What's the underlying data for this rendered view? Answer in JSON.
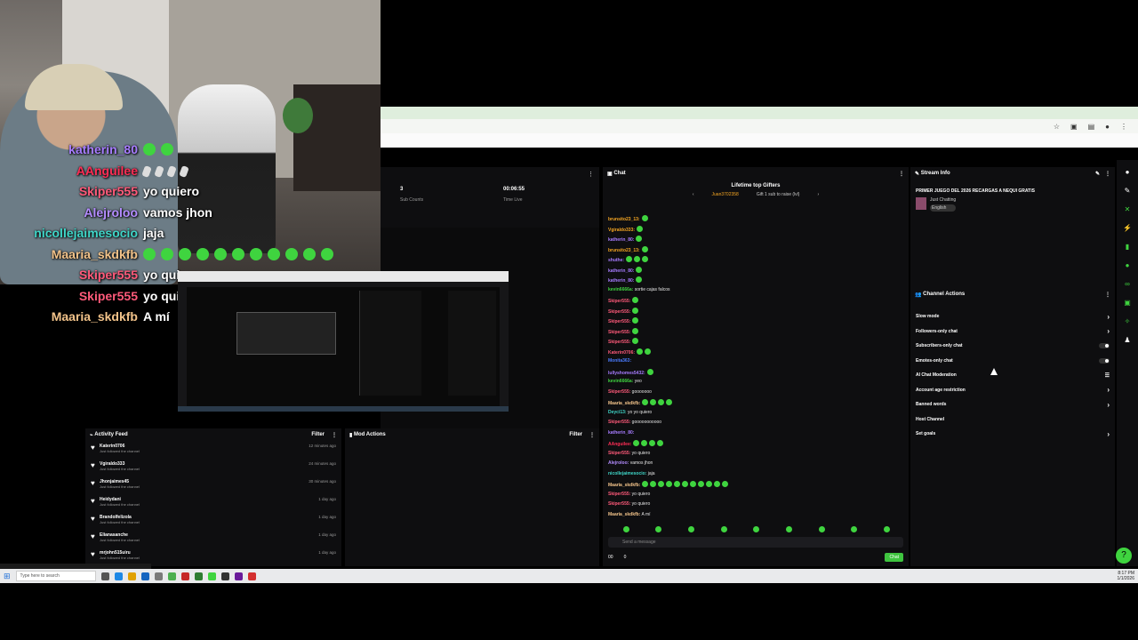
{
  "overlay_chat": [
    {
      "name": "katherin_80",
      "name_color": "#a77cff",
      "msg": "",
      "emotes": 2
    },
    {
      "name": "AAnguilee",
      "name_color": "#ff2d55",
      "msg": "",
      "emotes": 4,
      "emote_type": "alt"
    },
    {
      "name": "Skiper555",
      "name_color": "#ff5a7a",
      "msg": "yo quiero",
      "emotes": 0
    },
    {
      "name": "Alejroloo",
      "name_color": "#b48cff",
      "msg": "vamos jhon",
      "emotes": 0
    },
    {
      "name": "nicollejaimesocio",
      "name_color": "#3fd6c8",
      "msg": "jaja",
      "emotes": 0
    },
    {
      "name": "Maaria_skdkfb",
      "name_color": "#f2c38a",
      "msg": "",
      "emotes": 11
    },
    {
      "name": "Skiper555",
      "name_color": "#ff5a7a",
      "msg": "yo quiero",
      "emotes": 0
    },
    {
      "name": "Skiper555",
      "name_color": "#ff5a7a",
      "msg": "yo quiero",
      "emotes": 0
    },
    {
      "name": "Maaria_skdkfb",
      "name_color": "#f2c38a",
      "msg": "A mí",
      "emotes": 0
    }
  ],
  "stats": {
    "sub_count": "3",
    "sub_label": "Sub Counts",
    "time_live": "00:06:55",
    "time_label": "Time Live"
  },
  "activity": {
    "title": "Activity Feed",
    "filter": "Filter",
    "items": [
      {
        "name": "Katerin0706",
        "sub": "Just followed the channel",
        "time": "12 minutes ago"
      },
      {
        "name": "Vgiraldo333",
        "sub": "Just followed the channel",
        "time": "24 minutes ago"
      },
      {
        "name": "Jhonjaimes45",
        "sub": "Just followed the channel",
        "time": "30 minutes ago"
      },
      {
        "name": "Heidydani",
        "sub": "Just followed the channel",
        "time": "1 day ago"
      },
      {
        "name": "Brandolfelizola",
        "sub": "Just followed the channel",
        "time": "1 day ago"
      },
      {
        "name": "Elianasanche",
        "sub": "Just followed the channel",
        "time": "1 day ago"
      },
      {
        "name": "mrjohn515uiru",
        "sub": "Just followed the channel",
        "time": "1 day ago"
      }
    ]
  },
  "mod_actions": {
    "title": "Mod Actions",
    "filter": "Filter"
  },
  "chat": {
    "title": "Chat",
    "gifters_title": "Lifetime top Gifters",
    "gifter_name": "Juan3702358",
    "gifter_note": "Gift 1 sub to raise (lvl)",
    "placeholder": "Send a message",
    "counter_a": "00",
    "counter_b": "0",
    "send_label": "Chat",
    "lines": [
      {
        "name": "brunsito23_13:",
        "color": "#f5a623",
        "msg": "",
        "em": 1
      },
      {
        "name": "Vgiraldo333:",
        "color": "#f5a623",
        "msg": "",
        "em": 1
      },
      {
        "name": "katherin_80:",
        "color": "#a77cff",
        "msg": "",
        "em": 1
      },
      {
        "name": "brunsito23_13:",
        "color": "#f5a623",
        "msg": "",
        "em": 1
      },
      {
        "name": "shuthe:",
        "color": "#a77cff",
        "msg": "",
        "em": 3
      },
      {
        "name": "katherin_80:",
        "color": "#a77cff",
        "msg": "",
        "em": 1
      },
      {
        "name": "katherin_80:",
        "color": "#a77cff",
        "msg": "",
        "em": 1
      },
      {
        "name": "kevin6666a:",
        "color": "#3fd43f",
        "msg": "sortie cajas falcos",
        "em": 0
      },
      {
        "name": "Skiper555:",
        "color": "#ff5a7a",
        "msg": "",
        "em": 1
      },
      {
        "name": "Skiper555:",
        "color": "#ff5a7a",
        "msg": "",
        "em": 1
      },
      {
        "name": "Skiper555:",
        "color": "#ff5a7a",
        "msg": "",
        "em": 1
      },
      {
        "name": "Skiper555:",
        "color": "#ff5a7a",
        "msg": "",
        "em": 1
      },
      {
        "name": "Skiper555:",
        "color": "#ff5a7a",
        "msg": "",
        "em": 1
      },
      {
        "name": "Katerin0706:",
        "color": "#ff5a7a",
        "msg": "",
        "em": 2
      },
      {
        "name": "Monita363:",
        "color": "#4a7bff",
        "msg": "",
        "em": 0
      },
      {
        "name": "lullyshomes5432:",
        "color": "#a77cff",
        "msg": "",
        "em": 1
      },
      {
        "name": "kevin6666a:",
        "color": "#3fd43f",
        "msg": "yeo",
        "em": 0
      },
      {
        "name": "Skiper555:",
        "color": "#ff5a7a",
        "msg": "gooooooo",
        "em": 0
      },
      {
        "name": "Maaria_skdkfb:",
        "color": "#f2c38a",
        "msg": "",
        "em": 4
      },
      {
        "name": "Deyci13:",
        "color": "#3fd6c8",
        "msg": "yo yo quiero",
        "em": 0
      },
      {
        "name": "Skiper555:",
        "color": "#ff5a7a",
        "msg": "gooooooooooo",
        "em": 0
      },
      {
        "name": "katherin_80:",
        "color": "#a77cff",
        "msg": "",
        "em": 0
      },
      {
        "name": "AAnguilee:",
        "color": "#ff2d55",
        "msg": "",
        "em": 4
      },
      {
        "name": "Skiper555:",
        "color": "#ff5a7a",
        "msg": "yo quiero",
        "em": 0
      },
      {
        "name": "Alejroloo:",
        "color": "#b48cff",
        "msg": "vamos jhon",
        "em": 0
      },
      {
        "name": "nicollejaimesocio:",
        "color": "#3fd6c8",
        "msg": "jaja",
        "em": 0
      },
      {
        "name": "Maaria_skdkfb:",
        "color": "#f2c38a",
        "msg": "",
        "em": 11
      },
      {
        "name": "Skiper555:",
        "color": "#ff5a7a",
        "msg": "yo quiero",
        "em": 0
      },
      {
        "name": "Skiper555:",
        "color": "#ff5a7a",
        "msg": "yo quiero",
        "em": 0
      },
      {
        "name": "Maaria_skdkfb:",
        "color": "#f2c38a",
        "msg": "A mí",
        "em": 0
      }
    ]
  },
  "stream_info": {
    "title": "Stream Info",
    "stream_title": "PRIMER JUEGO DEL 2026 RECARGAS A NEQUI GRATIS",
    "category": "Just Chatting",
    "tag": "English"
  },
  "channel_actions": {
    "title": "Channel Actions",
    "items": [
      {
        "label": "Slow mode",
        "control": "chevron"
      },
      {
        "label": "Followers-only chat",
        "control": "chevron"
      },
      {
        "label": "Subscribers-only chat",
        "control": "toggle"
      },
      {
        "label": "Emotes-only chat",
        "control": "toggle"
      },
      {
        "label": "AI Chat Moderation",
        "control": "settings"
      },
      {
        "label": "Account age restriction",
        "control": "chevron"
      },
      {
        "label": "Banned words",
        "control": "chevron"
      },
      {
        "label": "Host Channel",
        "control": "none"
      },
      {
        "label": "Set goals",
        "control": "chevron"
      }
    ]
  },
  "taskbar": {
    "search_placeholder": "Type here to search",
    "time": "8:17 PM",
    "date": "1/1/2026"
  },
  "colors": {
    "accent": "#3fd43f",
    "panel_bg": "#0e0e10"
  }
}
